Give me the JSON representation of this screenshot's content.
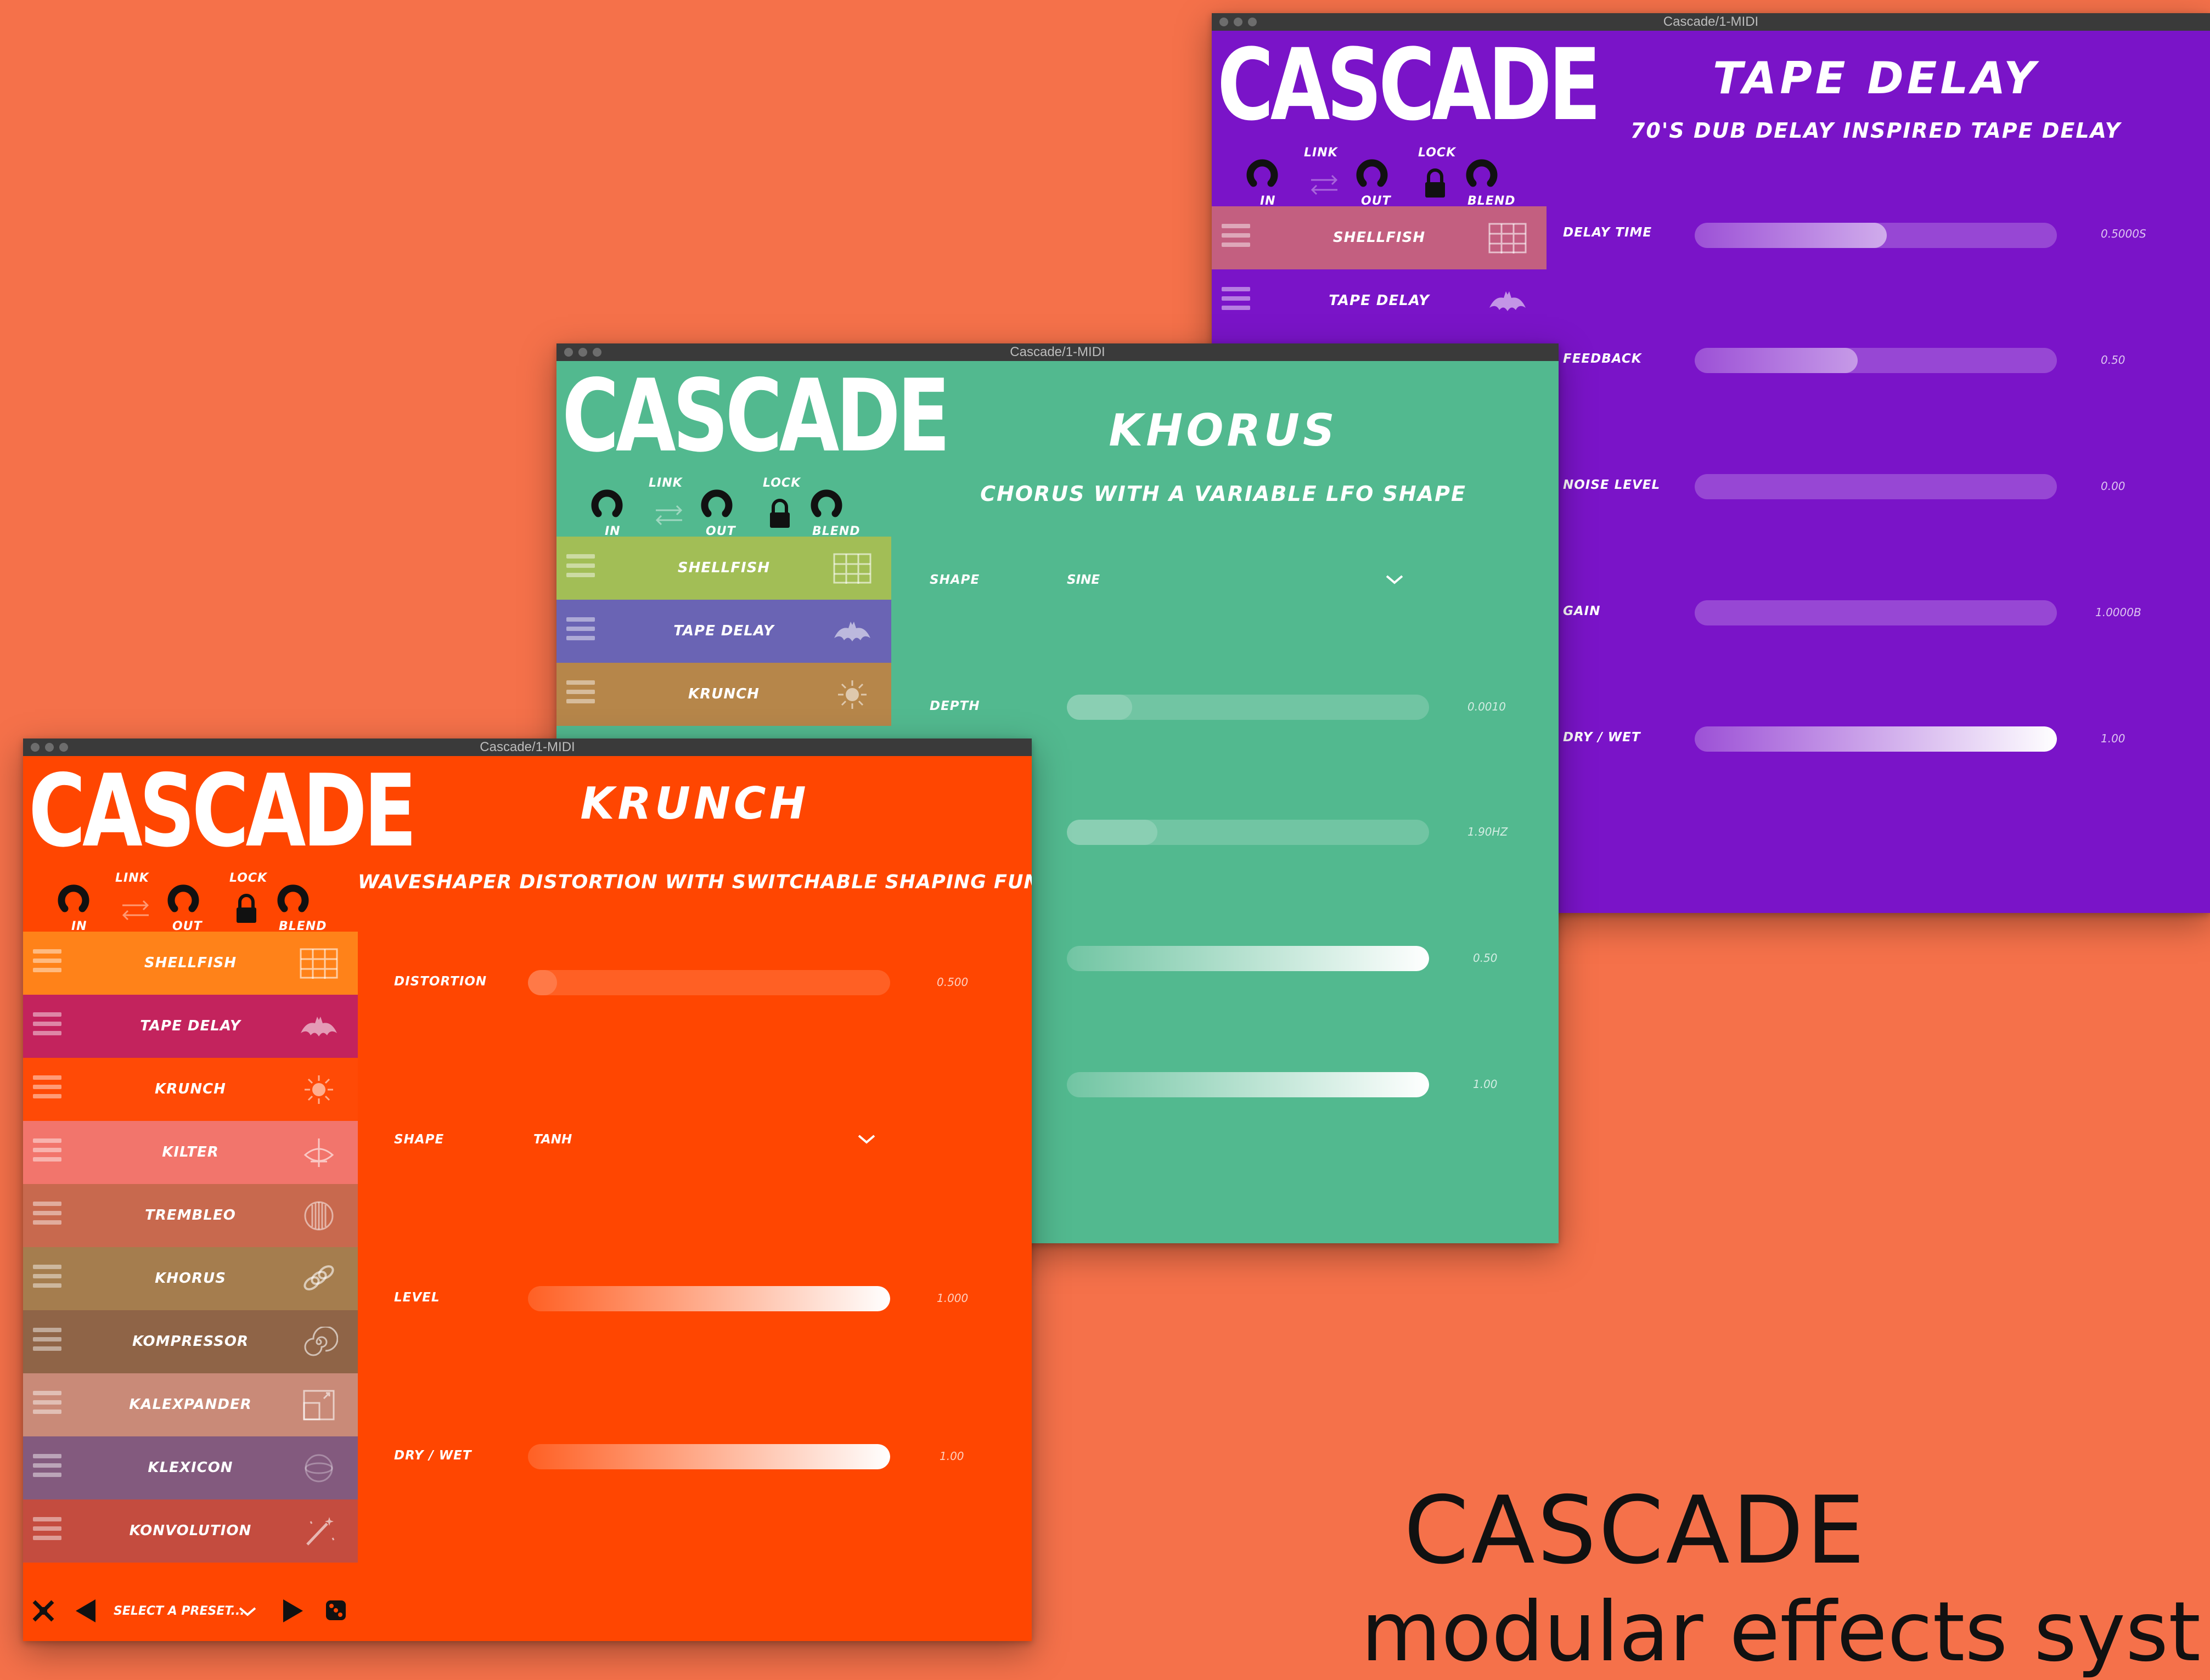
{
  "window_title": "Cascade/1-MIDI",
  "app_logo": "CASCADE",
  "controls": {
    "in": "IN",
    "out": "OUT",
    "blend": "BLEND",
    "link": "LINK",
    "lock": "LOCK"
  },
  "windows": {
    "tape_delay": {
      "title": "TAPE DELAY",
      "subtitle": "70'S DUB DELAY INSPIRED TAPE DELAY",
      "bg_color": "#7A14C8",
      "sidebar_items": [
        {
          "label": "SHELLFISH",
          "color": "#C35F80",
          "icon": "grid-icon"
        },
        {
          "label": "TAPE DELAY",
          "color": "#7A14C8",
          "icon": "bat-icon"
        }
      ],
      "params": [
        {
          "label": "DELAY TIME",
          "value": "0.5000S",
          "fraction": 0.53
        },
        {
          "label": "FEEDBACK",
          "value": "0.50",
          "fraction": 0.45
        },
        {
          "label": "NOISE LEVEL",
          "value": "0.00",
          "fraction": 0.0
        },
        {
          "label": "GAIN",
          "value": "1.0000B",
          "fraction": 0.0
        },
        {
          "label": "DRY / WET",
          "value": "1.00",
          "fraction": 1.0
        }
      ]
    },
    "khorus": {
      "title": "KHORUS",
      "subtitle": "CHORUS WITH A VARIABLE LFO SHAPE",
      "bg_color": "#52B98F",
      "sidebar_items": [
        {
          "label": "SHELLFISH",
          "color": "#A2BE56",
          "icon": "grid-icon"
        },
        {
          "label": "TAPE DELAY",
          "color": "#6A64B4",
          "icon": "bat-icon"
        },
        {
          "label": "KRUNCH",
          "color": "#B6864A",
          "icon": "sun-icon"
        }
      ],
      "shape": {
        "label": "SHAPE",
        "value": "SINE"
      },
      "params": [
        {
          "label": "DEPTH",
          "value": "0.0010",
          "fraction": 0.18
        },
        {
          "label": "",
          "value": "1.90HZ",
          "fraction": 0.25
        },
        {
          "label": "",
          "value": "0.50",
          "fraction": 1.0
        },
        {
          "label": "",
          "value": "1.00",
          "fraction": 1.0
        }
      ]
    },
    "krunch": {
      "title": "KRUNCH",
      "subtitle": "WAVESHAPER DISTORTION WITH SWITCHABLE SHAPING FUNCTIONS",
      "bg_color": "#FF4601",
      "sidebar_items": [
        {
          "label": "SHELLFISH",
          "color": "#FF8219",
          "icon": "grid-icon"
        },
        {
          "label": "TAPE DELAY",
          "color": "#C3235D",
          "icon": "bat-icon"
        },
        {
          "label": "KRUNCH",
          "color": "#FF4A06",
          "icon": "sun-icon"
        },
        {
          "label": "KILTER",
          "color": "#F2756C",
          "icon": "compass-icon"
        },
        {
          "label": "TREMBLEO",
          "color": "#C8694E",
          "icon": "lines-circle-icon"
        },
        {
          "label": "KHORUS",
          "color": "#A57D4E",
          "icon": "chain-icon"
        },
        {
          "label": "KOMPRESSOR",
          "color": "#8F6447",
          "icon": "spiral-icon"
        },
        {
          "label": "KALEXPANDER",
          "color": "#C98A78",
          "icon": "frame-icon"
        },
        {
          "label": "KLEXICON",
          "color": "#835A7E",
          "icon": "sphere-icon"
        },
        {
          "label": "KONVOLUTION",
          "color": "#C44C3F",
          "icon": "wand-icon"
        }
      ],
      "params": [
        {
          "label": "DISTORTION",
          "value": "0.500",
          "fraction": 0.08
        },
        {
          "label": "LEVEL",
          "value": "1.000",
          "fraction": 1.0
        },
        {
          "label": "DRY / WET",
          "value": "1.00",
          "fraction": 1.0
        }
      ],
      "shape": {
        "label": "SHAPE",
        "value": "TANH"
      },
      "preset": "SELECT A PRESET..."
    }
  },
  "promo": {
    "line1": "CASCADE",
    "line2": "modular effects syst"
  }
}
